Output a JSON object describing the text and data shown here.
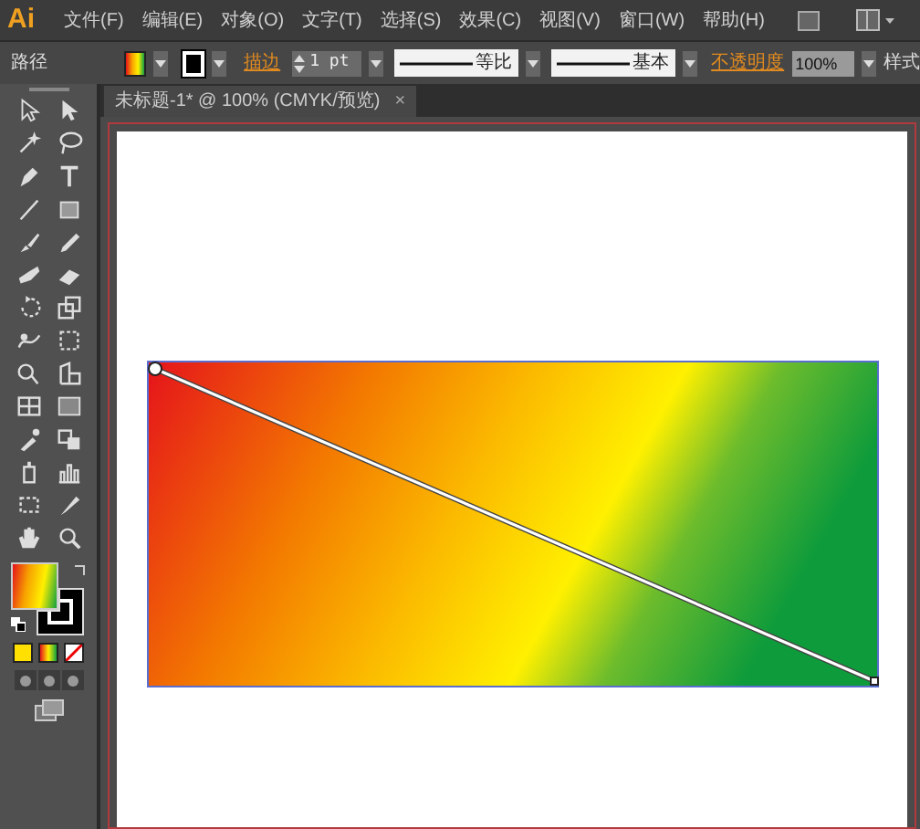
{
  "app": {
    "logo": "Ai"
  },
  "menu": [
    {
      "label": "文件(F)"
    },
    {
      "label": "编辑(E)"
    },
    {
      "label": "对象(O)"
    },
    {
      "label": "文字(T)"
    },
    {
      "label": "选择(S)"
    },
    {
      "label": "效果(C)"
    },
    {
      "label": "视图(V)"
    },
    {
      "label": "窗口(W)"
    },
    {
      "label": "帮助(H)"
    }
  ],
  "control_bar": {
    "object_type": "路径",
    "stroke_label": "描边",
    "stroke_weight": "1 pt",
    "profile": "等比",
    "brush": "基本",
    "opacity_label": "不透明度",
    "opacity": "100%",
    "style_label": "样式"
  },
  "tabs": [
    {
      "label": "未标题-1* @ 100% (CMYK/预览)",
      "selected": true,
      "close": "×"
    }
  ]
}
